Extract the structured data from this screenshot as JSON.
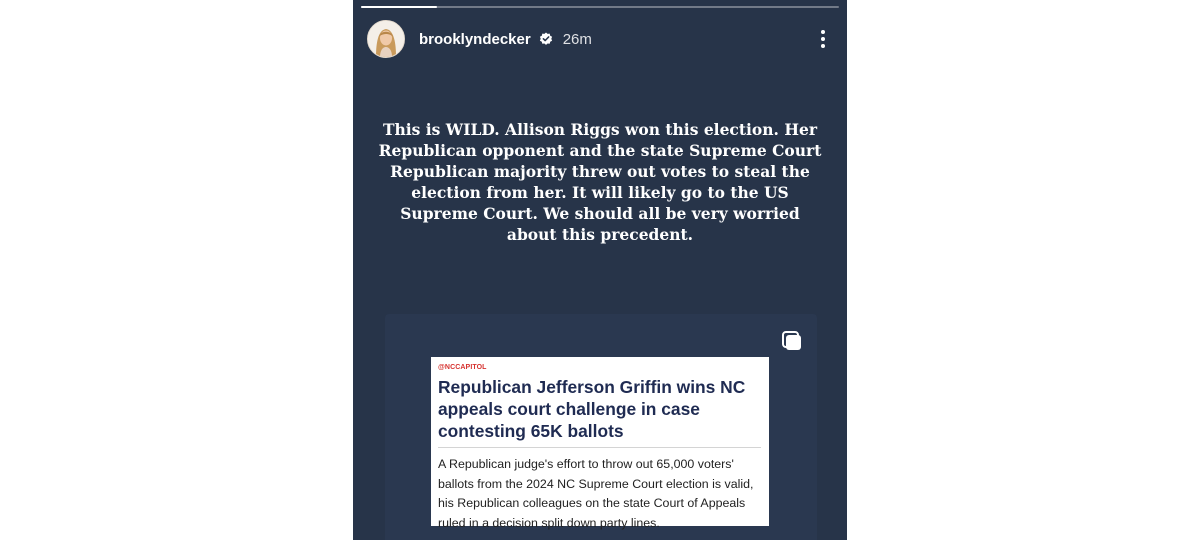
{
  "story": {
    "progress": 0.16,
    "username": "brooklyndecker",
    "verified": true,
    "time": "26m",
    "caption": "This is WILD. Allison Riggs won this election. Her Republican opponent and the state Supreme Court Republican majority threw out votes to steal the election from her. It will likely go to the US Supreme Court. We should all be very worried about this precedent."
  },
  "article": {
    "kicker": "@NCCAPITOL",
    "headline": "Republican Jefferson Griffin wins NC appeals court challenge in case contesting 65K ballots",
    "summary": "A Republican judge's effort to throw out 65,000 voters' ballots from the 2024 NC Supreme Court election is valid, his Republican colleagues on the state Court of Appeals ruled in a decision split down party lines."
  },
  "icons": {
    "more": "more-vertical-icon",
    "verified": "verified-badge-icon",
    "repost": "repost-icon"
  },
  "colors": {
    "background": "#273449",
    "headline": "#1f2b52",
    "kicker": "#d6322f"
  }
}
